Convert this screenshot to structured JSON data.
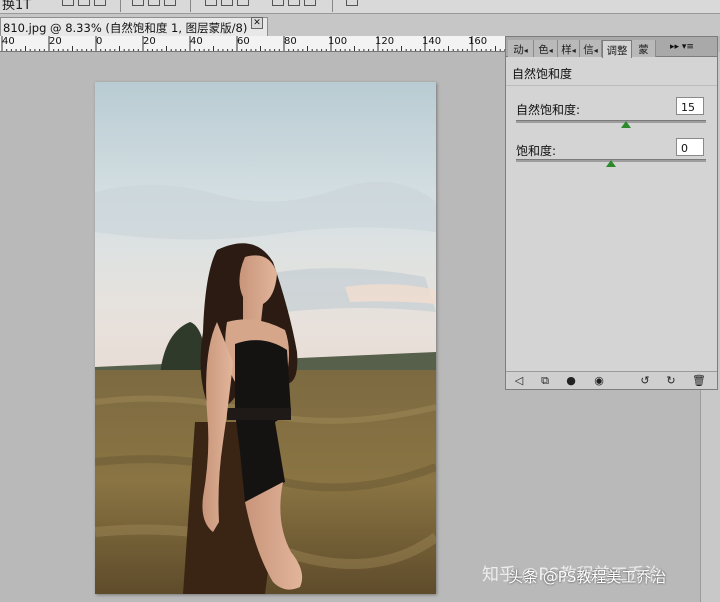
{
  "toolbar": {
    "partial_text": "换1T"
  },
  "document": {
    "tab_title": "810.jpg @ 8.33% (自然饱和度 1, 图层蒙版/8) *",
    "close_glyph": "✕"
  },
  "ruler": {
    "labels": [
      "40",
      "20",
      "0",
      "20",
      "40",
      "60",
      "80",
      "100",
      "120",
      "140",
      "160"
    ]
  },
  "panel": {
    "tabs": [
      "动",
      "色",
      "样",
      "信",
      "调整",
      "蒙"
    ],
    "active_tab": "调整",
    "menu_glyph": "▸▸ ▾≡",
    "title": "自然饱和度",
    "vibrance": {
      "label": "自然饱和度:",
      "value": "15",
      "fraction": 0.58
    },
    "saturation": {
      "label": "饱和度:",
      "value": "0",
      "fraction": 0.5
    }
  },
  "watermark": {
    "text": "知乎 @PS教程美工乔治",
    "overlay_text": "头条 @PS教程美工乔治"
  },
  "colors": {
    "accent_thumb": "#2c8a2c",
    "workspace": "#b9b9b9",
    "panel_bg": "#d4d4d4"
  }
}
